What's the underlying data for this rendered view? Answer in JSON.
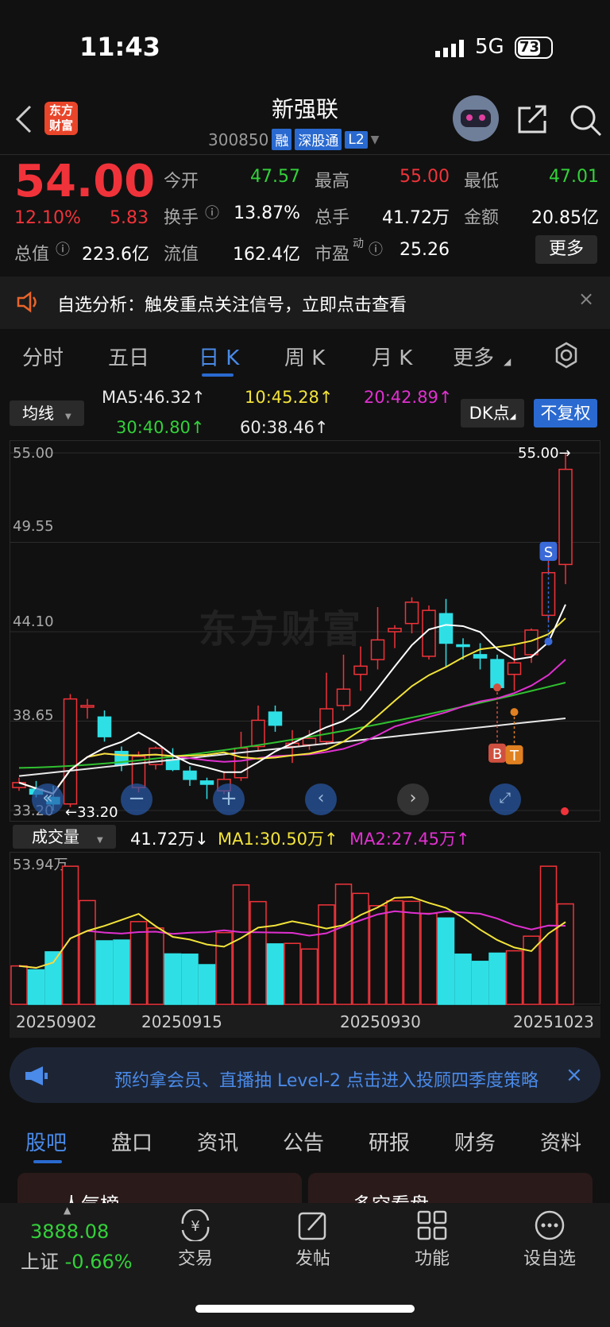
{
  "status": {
    "time": "11:43",
    "network": "5G",
    "battery": "73"
  },
  "header": {
    "logo": "东方财富",
    "stock_name": "新强联",
    "code": "300850",
    "tags": [
      "融",
      "深股通",
      "L2"
    ]
  },
  "quote": {
    "price": "54.00",
    "change_pct": "12.10%",
    "change": "5.83",
    "fields": [
      {
        "label": "今开",
        "value": "47.57"
      },
      {
        "label": "最高",
        "value": "55.00"
      },
      {
        "label": "最低",
        "value": "47.01"
      },
      {
        "label": "换手",
        "value": "13.87%"
      },
      {
        "label": "总手",
        "value": "41.72万"
      },
      {
        "label": "金额",
        "value": "20.85亿"
      },
      {
        "label": "总值",
        "value": "223.6亿"
      },
      {
        "label": "流值",
        "value": "162.4亿"
      },
      {
        "label": "市盈",
        "value": "25.26"
      }
    ],
    "pe_sup": "动",
    "more": "更多"
  },
  "notice": {
    "text": "自选分析：触发重点关注信号，立即点击查看",
    "close": "×"
  },
  "period_tabs": [
    "分时",
    "五日",
    "日 K",
    "周 K",
    "月 K",
    "更多"
  ],
  "ma": {
    "select": "均线",
    "ma5": "MA5:46.32↑",
    "ma10": "10:45.28↑",
    "ma20": "20:42.89↑",
    "ma30": "30:40.80↑",
    "ma60": "60:38.46↑",
    "dk": "DK点",
    "fq": "不复权"
  },
  "chart_data": {
    "type": "candlestick",
    "y_ticks": [
      "55.00",
      "49.55",
      "44.10",
      "38.65",
      "33.20"
    ],
    "ylim": [
      33.2,
      55.0
    ],
    "max_label": "55.00",
    "min_label": "33.20",
    "watermark": "东方财富",
    "markers": [
      "S",
      "B",
      "T"
    ],
    "candles": [
      [
        34.6,
        35.2,
        34.4,
        34.9
      ],
      [
        34.5,
        35.0,
        34.0,
        34.2
      ],
      [
        34.0,
        34.7,
        33.2,
        33.6
      ],
      [
        33.6,
        40.3,
        33.4,
        40.0
      ],
      [
        39.5,
        40.0,
        38.8,
        39.6
      ],
      [
        38.9,
        39.3,
        37.4,
        37.7
      ],
      [
        36.8,
        37.1,
        35.6,
        36.0
      ],
      [
        34.6,
        36.8,
        34.3,
        36.5
      ],
      [
        36.0,
        37.1,
        35.7,
        37.0
      ],
      [
        36.3,
        37.0,
        35.6,
        35.7
      ],
      [
        35.6,
        35.9,
        34.7,
        35.1
      ],
      [
        35.0,
        35.2,
        33.9,
        34.8
      ],
      [
        34.4,
        35.6,
        34.2,
        35.1
      ],
      [
        35.2,
        38.0,
        35.0,
        37.0
      ],
      [
        37.1,
        39.6,
        36.8,
        38.7
      ],
      [
        39.2,
        39.6,
        38.0,
        38.4
      ],
      [
        37.1,
        38.1,
        36.1,
        37.3
      ],
      [
        37.2,
        38.1,
        36.9,
        37.6
      ],
      [
        37.4,
        41.6,
        37.2,
        39.4
      ],
      [
        39.6,
        42.7,
        39.3,
        40.6
      ],
      [
        41.5,
        43.2,
        40.5,
        42.0
      ],
      [
        42.4,
        45.6,
        41.8,
        43.6
      ],
      [
        44.1,
        44.5,
        43.1,
        44.3
      ],
      [
        44.6,
        46.2,
        44.0,
        45.9
      ],
      [
        42.6,
        45.7,
        42.4,
        45.4
      ],
      [
        45.2,
        46.1,
        41.9,
        43.4
      ],
      [
        43.3,
        43.7,
        42.4,
        43.2
      ],
      [
        42.7,
        43.4,
        41.8,
        42.5
      ],
      [
        42.4,
        42.7,
        40.5,
        40.7
      ],
      [
        41.5,
        43.2,
        40.5,
        42.2
      ],
      [
        42.7,
        44.3,
        42.2,
        44.2
      ],
      [
        45.1,
        48.5,
        44.8,
        47.7
      ],
      [
        48.2,
        55.0,
        47.0,
        54.0
      ]
    ],
    "volume": {
      "label": "成交量",
      "current": "41.72万↓",
      "ma1": "MA1:30.50万↑",
      "ma2": "MA2:27.45万↑",
      "max_label": "53.94万",
      "dates": [
        "20250902",
        "20250915",
        "20250930",
        "20251023"
      ],
      "bars": [
        15,
        13.5,
        20.5,
        53.9,
        40.5,
        24.8,
        25.1,
        32.3,
        29.8,
        19.7,
        19.6,
        15.5,
        28,
        46.6,
        40.1,
        23.6,
        23.8,
        21.6,
        38.8,
        46.9,
        43.3,
        38.5,
        40.4,
        40.2,
        35.5,
        33.7,
        19.6,
        16.8,
        20,
        20.9,
        26.6,
        53.9,
        39.2
      ]
    }
  },
  "banner": {
    "text": "预约拿会员、直播抽 Level-2 点击进入投顾四季度策略",
    "close": "×"
  },
  "bottom_tabs": [
    "股吧",
    "盘口",
    "资讯",
    "公告",
    "研报",
    "财务",
    "资料"
  ],
  "cards": [
    "人气榜",
    "多空看盘"
  ],
  "bottom_nav": {
    "index_value": "3888.08",
    "index_name": "上证",
    "index_change": "-0.66%",
    "items": [
      "交易",
      "发帖",
      "功能",
      "设自选"
    ]
  },
  "colors": {
    "up": "#f0333a",
    "down": "#2ee0e6",
    "accent": "#2a6ad0",
    "ma5": "#ffffff",
    "ma10": "#f2e33a",
    "ma20": "#e030d0",
    "ma30": "#30c030",
    "ma60": "#e8e8e8"
  }
}
